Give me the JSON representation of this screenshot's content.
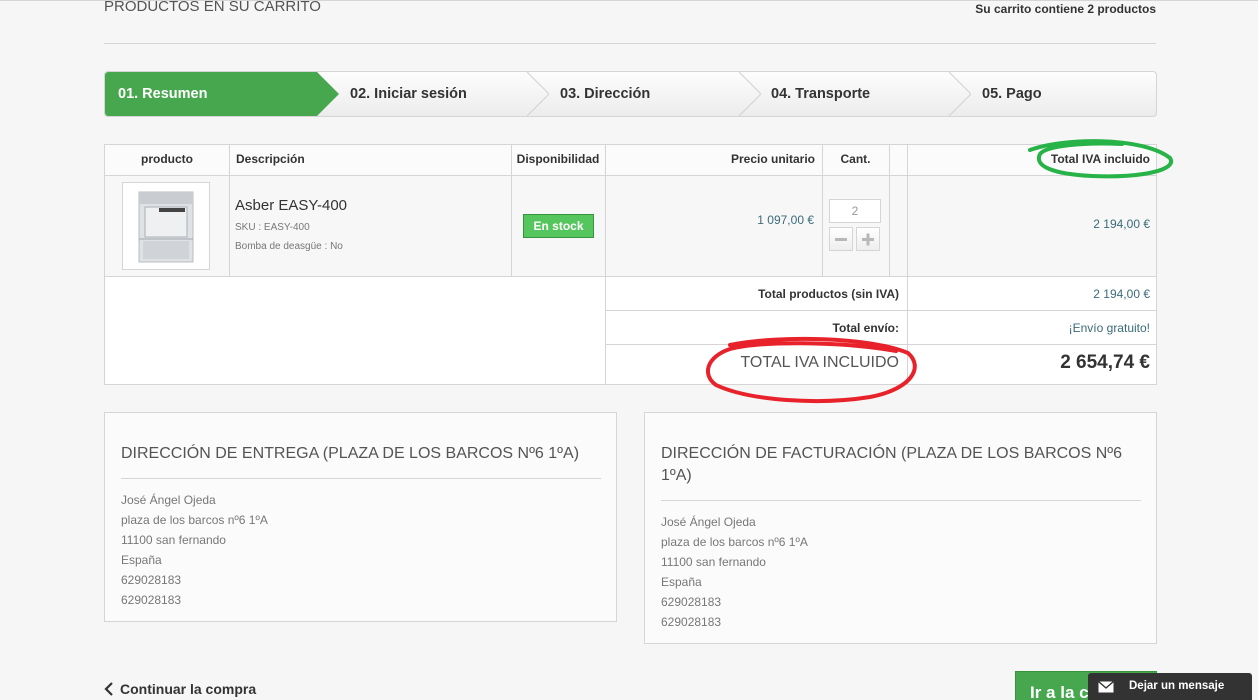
{
  "header": {
    "title": "PRODUCTOS EN SU CARRITO",
    "cart_count": "Su carrito contiene 2 productos"
  },
  "steps": [
    {
      "label": "01. Resumen",
      "active": true
    },
    {
      "label": "02. Iniciar sesión",
      "active": false
    },
    {
      "label": "03. Dirección",
      "active": false
    },
    {
      "label": "04. Transporte",
      "active": false
    },
    {
      "label": "05. Pago",
      "active": false
    }
  ],
  "table": {
    "headers": {
      "product": "producto",
      "description": "Descripción",
      "availability": "Disponibilidad",
      "unit_price": "Precio unitario",
      "qty": "Cant.",
      "total": "Total IVA incluido"
    },
    "item": {
      "name": "Asber EASY-400",
      "sku": "SKU : EASY-400",
      "attribute": "Bomba de deasgüe : No",
      "stock": "En stock",
      "unit_price": "1 097,00 €",
      "qty": "2",
      "line_total": "2 194,00 €",
      "minus_icon": "minus-icon",
      "plus_icon": "plus-icon"
    },
    "summary": {
      "products_label": "Total productos (sin IVA)",
      "products_value": "2 194,00 €",
      "shipping_label": "Total envío:",
      "shipping_value": "¡Envío gratuito!",
      "total_label": "TOTAL IVA INCLUIDO",
      "total_value": "2 654,74 €"
    }
  },
  "delivery_address": {
    "title": "DIRECCIÓN DE ENTREGA (PLAZA DE LOS BARCOS Nº6 1ºA)",
    "lines": [
      "José Ángel Ojeda",
      "plaza de los barcos nº6 1ºA",
      "11100 san fernando",
      "España",
      "629028183",
      "629028183"
    ]
  },
  "billing_address": {
    "title": "DIRECCIÓN DE FACTURACIÓN (PLAZA DE LOS BARCOS Nº6 1ºA)",
    "lines": [
      "José Ángel Ojeda",
      "plaza de los barcos nº6 1ºA",
      "11100 san fernando",
      "España",
      "629028183",
      "629028183"
    ]
  },
  "footer": {
    "continue_label": "Continuar la compra",
    "checkout_label": "Ir a la c",
    "chat_label": "Dejar un mensaje",
    "chat_icon": "envelope-icon",
    "back_icon": "chevron-left-icon"
  },
  "colors": {
    "accent_green": "#46a74e",
    "annotation_green": "#27b347",
    "annotation_red": "#e8222b"
  }
}
